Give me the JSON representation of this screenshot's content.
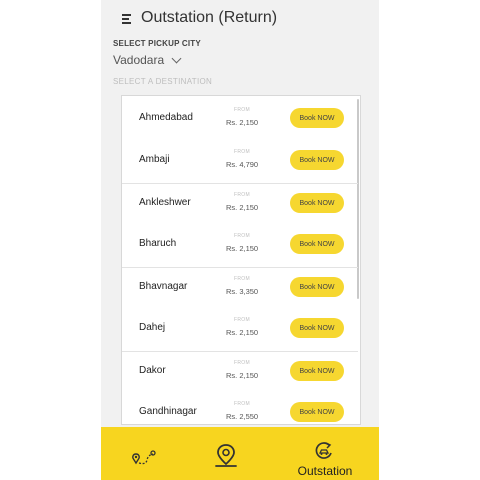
{
  "header": {
    "title": "Outstation (Return)",
    "menu_icon": "menu-icon"
  },
  "pickup": {
    "label": "SELECT PICKUP CITY",
    "city": "Vadodara"
  },
  "destination_label": "SELECT A DESTINATION",
  "from_label": "FROM",
  "book_label": "Book NOW",
  "destinations": [
    {
      "name": "Ahmedabad",
      "price": "Rs. 2,150"
    },
    {
      "name": "Ambaji",
      "price": "Rs. 4,790"
    },
    {
      "name": "Ankleshwer",
      "price": "Rs. 2,150"
    },
    {
      "name": "Bharuch",
      "price": "Rs. 2,150"
    },
    {
      "name": "Bhavnagar",
      "price": "Rs. 3,350"
    },
    {
      "name": "Dahej",
      "price": "Rs. 2,150"
    },
    {
      "name": "Dakor",
      "price": "Rs. 2,150"
    },
    {
      "name": "Gandhinagar",
      "price": "Rs. 2,550"
    }
  ],
  "bottom_nav": {
    "items": [
      {
        "icon": "route-pin-icon",
        "label": ""
      },
      {
        "icon": "location-pin-icon",
        "label": ""
      },
      {
        "icon": "outstation-icon",
        "label": "Outstation",
        "active": true
      }
    ]
  },
  "colors": {
    "accent": "#f7d51f",
    "button": "#f6d730",
    "background": "#f1f1f1"
  }
}
